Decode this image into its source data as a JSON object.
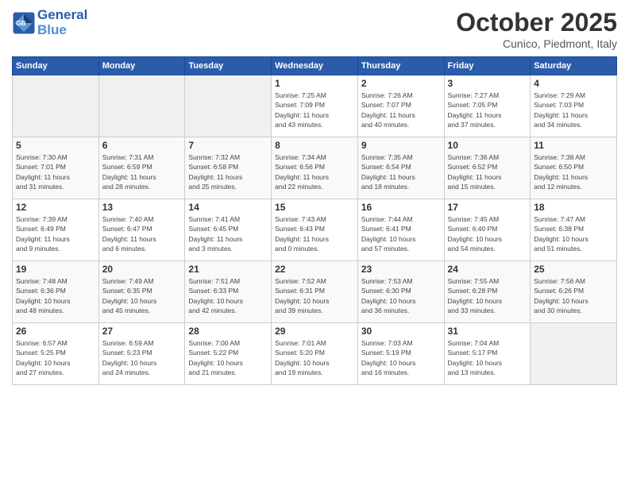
{
  "header": {
    "logo_line1": "General",
    "logo_line2": "Blue",
    "month": "October 2025",
    "location": "Cunico, Piedmont, Italy"
  },
  "days_of_week": [
    "Sunday",
    "Monday",
    "Tuesday",
    "Wednesday",
    "Thursday",
    "Friday",
    "Saturday"
  ],
  "weeks": [
    [
      {
        "day": "",
        "info": ""
      },
      {
        "day": "",
        "info": ""
      },
      {
        "day": "",
        "info": ""
      },
      {
        "day": "1",
        "info": "Sunrise: 7:25 AM\nSunset: 7:09 PM\nDaylight: 11 hours\nand 43 minutes."
      },
      {
        "day": "2",
        "info": "Sunrise: 7:26 AM\nSunset: 7:07 PM\nDaylight: 11 hours\nand 40 minutes."
      },
      {
        "day": "3",
        "info": "Sunrise: 7:27 AM\nSunset: 7:05 PM\nDaylight: 11 hours\nand 37 minutes."
      },
      {
        "day": "4",
        "info": "Sunrise: 7:29 AM\nSunset: 7:03 PM\nDaylight: 11 hours\nand 34 minutes."
      }
    ],
    [
      {
        "day": "5",
        "info": "Sunrise: 7:30 AM\nSunset: 7:01 PM\nDaylight: 11 hours\nand 31 minutes."
      },
      {
        "day": "6",
        "info": "Sunrise: 7:31 AM\nSunset: 6:59 PM\nDaylight: 11 hours\nand 28 minutes."
      },
      {
        "day": "7",
        "info": "Sunrise: 7:32 AM\nSunset: 6:58 PM\nDaylight: 11 hours\nand 25 minutes."
      },
      {
        "day": "8",
        "info": "Sunrise: 7:34 AM\nSunset: 6:56 PM\nDaylight: 11 hours\nand 22 minutes."
      },
      {
        "day": "9",
        "info": "Sunrise: 7:35 AM\nSunset: 6:54 PM\nDaylight: 11 hours\nand 18 minutes."
      },
      {
        "day": "10",
        "info": "Sunrise: 7:36 AM\nSunset: 6:52 PM\nDaylight: 11 hours\nand 15 minutes."
      },
      {
        "day": "11",
        "info": "Sunrise: 7:38 AM\nSunset: 6:50 PM\nDaylight: 11 hours\nand 12 minutes."
      }
    ],
    [
      {
        "day": "12",
        "info": "Sunrise: 7:39 AM\nSunset: 6:49 PM\nDaylight: 11 hours\nand 9 minutes."
      },
      {
        "day": "13",
        "info": "Sunrise: 7:40 AM\nSunset: 6:47 PM\nDaylight: 11 hours\nand 6 minutes."
      },
      {
        "day": "14",
        "info": "Sunrise: 7:41 AM\nSunset: 6:45 PM\nDaylight: 11 hours\nand 3 minutes."
      },
      {
        "day": "15",
        "info": "Sunrise: 7:43 AM\nSunset: 6:43 PM\nDaylight: 11 hours\nand 0 minutes."
      },
      {
        "day": "16",
        "info": "Sunrise: 7:44 AM\nSunset: 6:41 PM\nDaylight: 10 hours\nand 57 minutes."
      },
      {
        "day": "17",
        "info": "Sunrise: 7:45 AM\nSunset: 6:40 PM\nDaylight: 10 hours\nand 54 minutes."
      },
      {
        "day": "18",
        "info": "Sunrise: 7:47 AM\nSunset: 6:38 PM\nDaylight: 10 hours\nand 51 minutes."
      }
    ],
    [
      {
        "day": "19",
        "info": "Sunrise: 7:48 AM\nSunset: 6:36 PM\nDaylight: 10 hours\nand 48 minutes."
      },
      {
        "day": "20",
        "info": "Sunrise: 7:49 AM\nSunset: 6:35 PM\nDaylight: 10 hours\nand 45 minutes."
      },
      {
        "day": "21",
        "info": "Sunrise: 7:51 AM\nSunset: 6:33 PM\nDaylight: 10 hours\nand 42 minutes."
      },
      {
        "day": "22",
        "info": "Sunrise: 7:52 AM\nSunset: 6:31 PM\nDaylight: 10 hours\nand 39 minutes."
      },
      {
        "day": "23",
        "info": "Sunrise: 7:53 AM\nSunset: 6:30 PM\nDaylight: 10 hours\nand 36 minutes."
      },
      {
        "day": "24",
        "info": "Sunrise: 7:55 AM\nSunset: 6:28 PM\nDaylight: 10 hours\nand 33 minutes."
      },
      {
        "day": "25",
        "info": "Sunrise: 7:56 AM\nSunset: 6:26 PM\nDaylight: 10 hours\nand 30 minutes."
      }
    ],
    [
      {
        "day": "26",
        "info": "Sunrise: 6:57 AM\nSunset: 5:25 PM\nDaylight: 10 hours\nand 27 minutes."
      },
      {
        "day": "27",
        "info": "Sunrise: 6:59 AM\nSunset: 5:23 PM\nDaylight: 10 hours\nand 24 minutes."
      },
      {
        "day": "28",
        "info": "Sunrise: 7:00 AM\nSunset: 5:22 PM\nDaylight: 10 hours\nand 21 minutes."
      },
      {
        "day": "29",
        "info": "Sunrise: 7:01 AM\nSunset: 5:20 PM\nDaylight: 10 hours\nand 19 minutes."
      },
      {
        "day": "30",
        "info": "Sunrise: 7:03 AM\nSunset: 5:19 PM\nDaylight: 10 hours\nand 16 minutes."
      },
      {
        "day": "31",
        "info": "Sunrise: 7:04 AM\nSunset: 5:17 PM\nDaylight: 10 hours\nand 13 minutes."
      },
      {
        "day": "",
        "info": ""
      }
    ]
  ]
}
